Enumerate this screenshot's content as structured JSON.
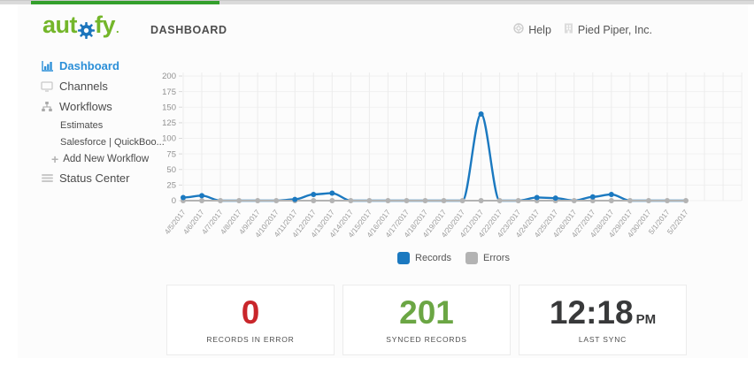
{
  "colors": {
    "progress_green": "#33a02c",
    "logo_green": "#74b62a",
    "gear_blue": "#1c75bc",
    "sidebar_active_blue": "#2b8fd8",
    "chart_blue": "#1b79c0",
    "chart_gray": "#b3b3b3",
    "error_red": "#c9262b",
    "success_green": "#6ba644",
    "clock_dark": "#38393a"
  },
  "logo": {
    "part1": "aut",
    "part2": "fy",
    "dot": "."
  },
  "header": {
    "title": "DASHBOARD",
    "help_label": "Help",
    "company_name": "Pied Piper, Inc."
  },
  "sidebar": {
    "items": [
      {
        "label": "Dashboard",
        "icon": "bar-chart-icon",
        "active": true
      },
      {
        "label": "Channels",
        "icon": "monitor-icon"
      },
      {
        "label": "Workflows",
        "icon": "sitemap-icon"
      },
      {
        "label": "Estimates",
        "type": "sub"
      },
      {
        "label": "Salesforce | QuickBoo...",
        "type": "sub"
      },
      {
        "label": "Add New Workflow",
        "icon": "plus-icon",
        "type": "add"
      },
      {
        "label": "Status Center",
        "icon": "list-icon"
      }
    ]
  },
  "chart_data": {
    "type": "line",
    "x": [
      "4/5/2017",
      "4/6/2017",
      "4/7/2017",
      "4/8/2017",
      "4/9/2017",
      "4/10/2017",
      "4/11/2017",
      "4/12/2017",
      "4/13/2017",
      "4/14/2017",
      "4/15/2017",
      "4/16/2017",
      "4/17/2017",
      "4/18/2017",
      "4/19/2017",
      "4/20/2017",
      "4/21/2017",
      "4/22/2017",
      "4/23/2017",
      "4/24/2017",
      "4/25/2017",
      "4/26/2017",
      "4/27/2017",
      "4/28/2017",
      "4/29/2017",
      "4/30/2017",
      "5/1/2017",
      "5/2/2017"
    ],
    "series": [
      {
        "name": "Records",
        "color": "#1b79c0",
        "values": [
          5,
          8,
          0,
          0,
          0,
          0,
          2,
          10,
          12,
          0,
          0,
          0,
          0,
          0,
          0,
          0,
          139,
          0,
          0,
          5,
          4,
          0,
          6,
          10,
          0,
          0,
          0,
          0
        ]
      },
      {
        "name": "Errors",
        "color": "#b3b3b3",
        "values": [
          0,
          0,
          0,
          0,
          0,
          0,
          0,
          0,
          0,
          0,
          0,
          0,
          0,
          0,
          0,
          0,
          0,
          0,
          0,
          0,
          0,
          0,
          0,
          0,
          0,
          0,
          0,
          0
        ]
      }
    ],
    "ylim": [
      0,
      200
    ],
    "yticks": [
      0,
      25,
      50,
      75,
      100,
      125,
      150,
      175,
      200
    ],
    "grid": true,
    "legend_position": "bottom",
    "title": "",
    "xlabel": "",
    "ylabel": ""
  },
  "stats": [
    {
      "value": "0",
      "label": "RECORDS IN ERROR",
      "color": "#c9262b"
    },
    {
      "value": "201",
      "label": "SYNCED RECORDS",
      "color": "#6ba644"
    },
    {
      "value": "12:18",
      "suffix": "PM",
      "label": "LAST SYNC",
      "color": "#38393a"
    }
  ]
}
